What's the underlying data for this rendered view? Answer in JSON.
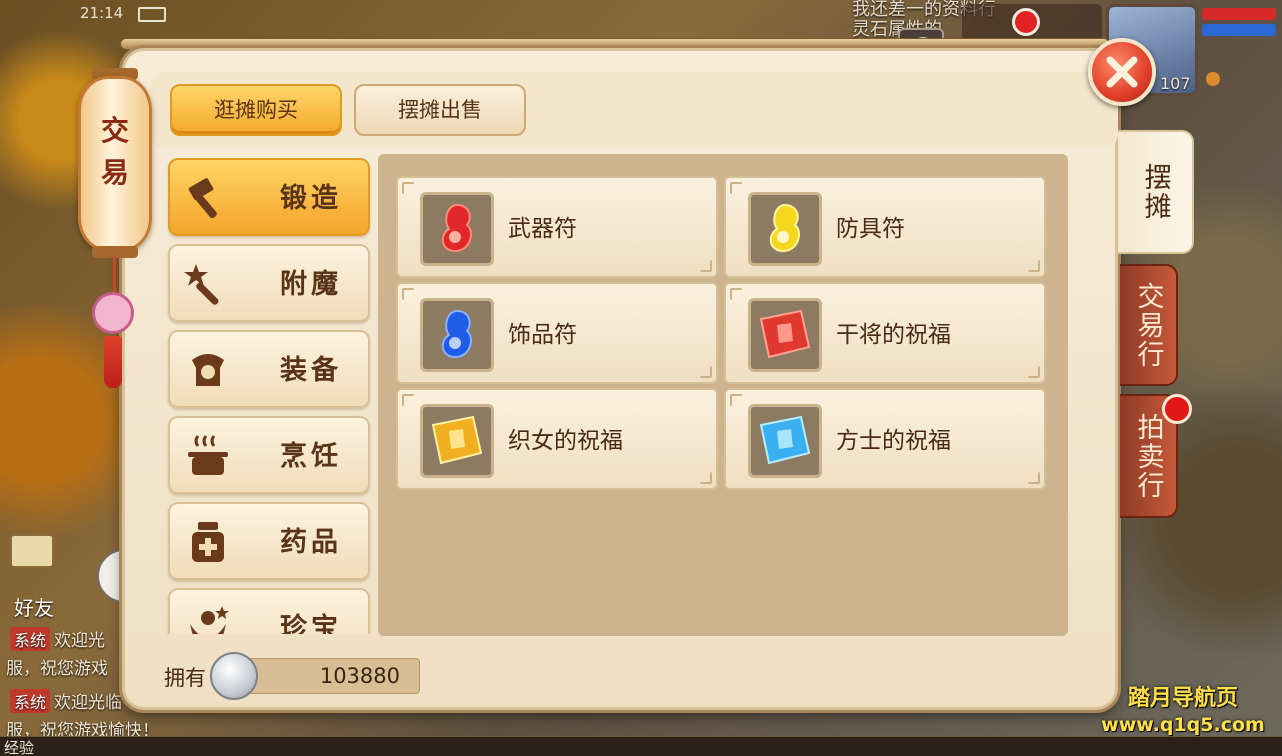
{
  "hud": {
    "time": "21:14",
    "status_text_line1": "我还差一的资料行",
    "status_text_line2": "灵石属性的",
    "level": "107"
  },
  "background": {
    "friends_label": "好友",
    "chat": [
      {
        "tag": "系统",
        "text": "欢迎光"
      },
      {
        "tag": "",
        "text": "服，祝您游戏"
      },
      {
        "tag": "系统",
        "text": "欢迎光临"
      },
      {
        "tag": "",
        "text": "服，祝您游戏愉快！"
      }
    ],
    "exp_label": "经验"
  },
  "panel": {
    "lantern_title": "交易",
    "tabs": {
      "browse_buy": "逛摊购买",
      "stall_sell": "摆摊出售"
    },
    "categories": [
      {
        "label": "锻造",
        "icon": "hammer-icon"
      },
      {
        "label": "附魔",
        "icon": "magic-wand-icon"
      },
      {
        "label": "装备",
        "icon": "armor-icon"
      },
      {
        "label": "烹饪",
        "icon": "cooking-pot-icon"
      },
      {
        "label": "药品",
        "icon": "medicine-bottle-icon"
      },
      {
        "label": "珍宝",
        "icon": "treasure-icon"
      }
    ],
    "items": [
      {
        "name": "武器符",
        "icon": "red-talisman-icon",
        "color": "#e0282a"
      },
      {
        "name": "防具符",
        "icon": "yellow-talisman-icon",
        "color": "#f4d820"
      },
      {
        "name": "饰品符",
        "icon": "blue-talisman-icon",
        "color": "#1f5ce8"
      },
      {
        "name": "干将的祝福",
        "icon": "red-scroll-icon",
        "color": "#e03a30"
      },
      {
        "name": "织女的祝福",
        "icon": "gold-scroll-icon",
        "color": "#f0b020"
      },
      {
        "name": "方士的祝福",
        "icon": "blue-scroll-icon",
        "color": "#3ab0f0"
      }
    ],
    "currency": {
      "label": "拥有",
      "value": "103880",
      "icon": "silver-coin-icon"
    },
    "side_tabs": {
      "stall": "摆摊",
      "trading_house": "交易行",
      "auction": "拍卖行"
    }
  },
  "watermark": {
    "line1": "踏月导航页",
    "line2": "www.q1q5.com"
  },
  "colors": {
    "active_tab": "#f3a92a",
    "panel_bg": "#f6ecd8",
    "side_tab_inactive": "#c65a3a",
    "alert_dot": "#e01818"
  }
}
